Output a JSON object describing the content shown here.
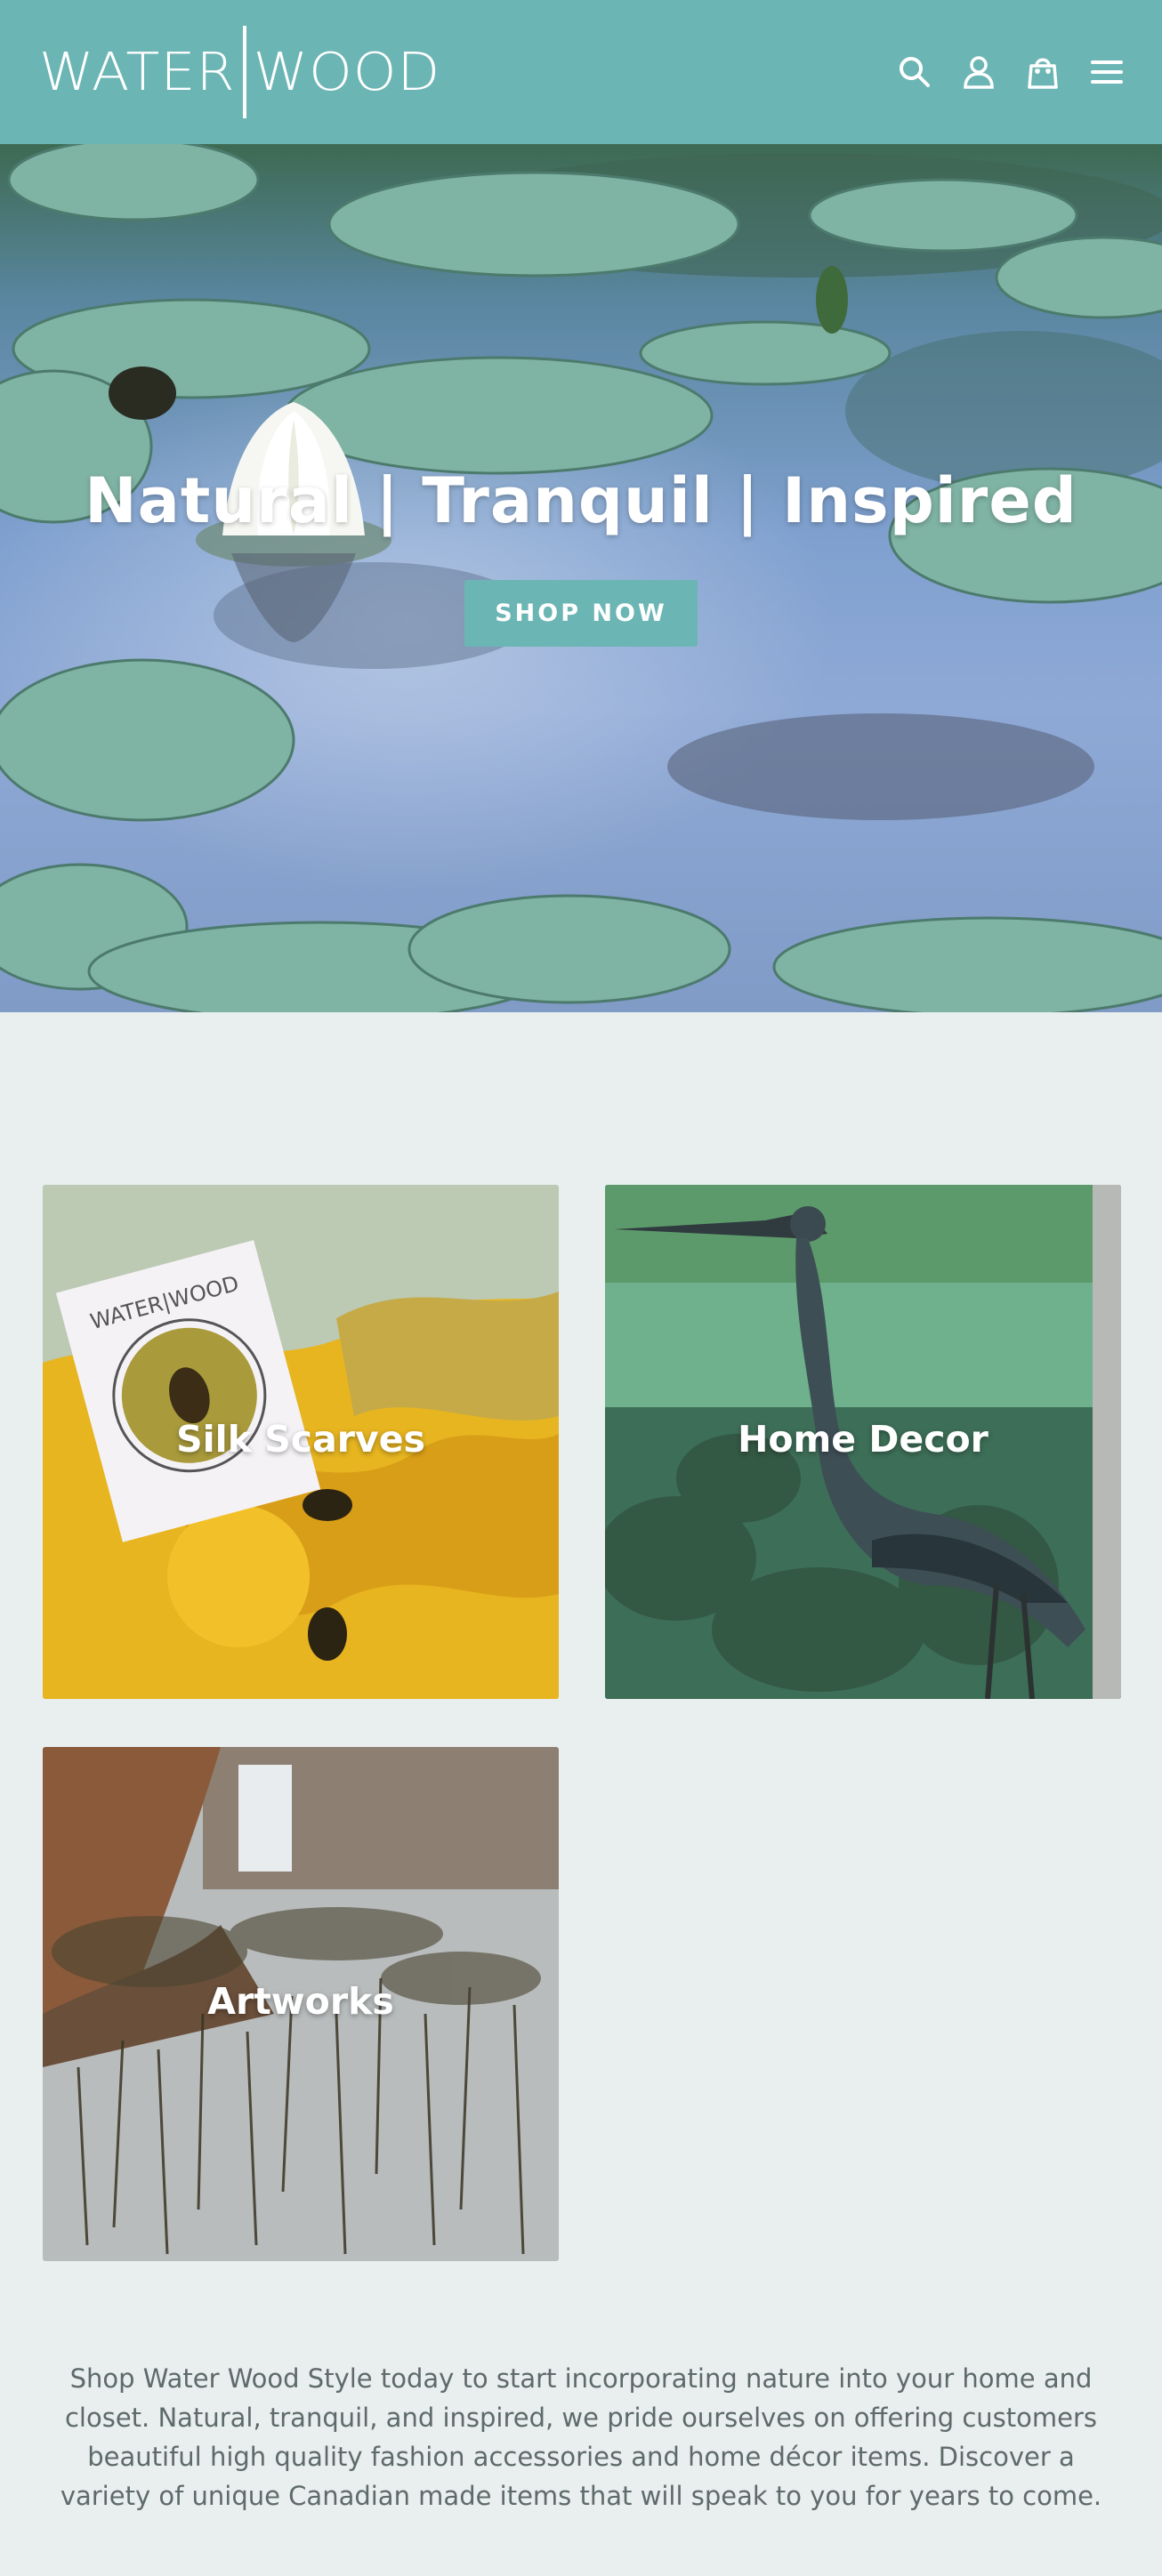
{
  "header": {
    "logo_left": "WATER",
    "logo_right": "WOOD",
    "icons": [
      "search-icon",
      "account-icon",
      "cart-icon",
      "menu-icon"
    ]
  },
  "hero": {
    "title": "Natural | Tranquil | Inspired",
    "button_label": "SHOP NOW"
  },
  "collections": [
    {
      "title": "Silk Scarves"
    },
    {
      "title": "Home Decor"
    },
    {
      "title": "Artworks"
    }
  ],
  "description": "Shop Water Wood Style today to start incorporating nature into your home and closet. Natural, tranquil, and inspired, we pride ourselves on offering customers beautiful high quality fashion accessories and home décor items. Discover a variety of unique Canadian made items that will speak to you for years to come.",
  "colors": {
    "brand_teal": "#6bb5b4",
    "page_background": "#e9eeee",
    "text": "#5e6a6b"
  }
}
